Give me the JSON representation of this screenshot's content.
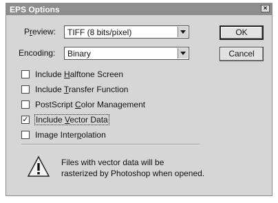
{
  "window": {
    "title": "EPS Options",
    "close_symbol": "×"
  },
  "preview": {
    "label_pre": "P",
    "label_u": "r",
    "label_post": "eview:",
    "value": "TIFF  (8 bits/pixel)"
  },
  "encoding": {
    "label_pre": "Encoding:",
    "value": "Binary"
  },
  "buttons": {
    "ok": "OK",
    "cancel": "Cancel"
  },
  "options": [
    {
      "pre": "Include ",
      "u": "H",
      "post": "alftone Screen",
      "checked": false
    },
    {
      "pre": "Include ",
      "u": "T",
      "post": "ransfer Function",
      "checked": false
    },
    {
      "pre": "PostScript ",
      "u": "C",
      "post": "olor Management",
      "checked": false
    },
    {
      "pre": "Include ",
      "u": "V",
      "post": "ector Data",
      "checked": true
    },
    {
      "pre": "Image Inter",
      "u": "p",
      "post": "olation",
      "checked": false
    }
  ],
  "message": {
    "line1": "Files with vector data will be",
    "line2": "rasterized by Photoshop when opened."
  },
  "icons": {
    "warning": "warning-triangle-icon",
    "check_mark": "✓"
  }
}
